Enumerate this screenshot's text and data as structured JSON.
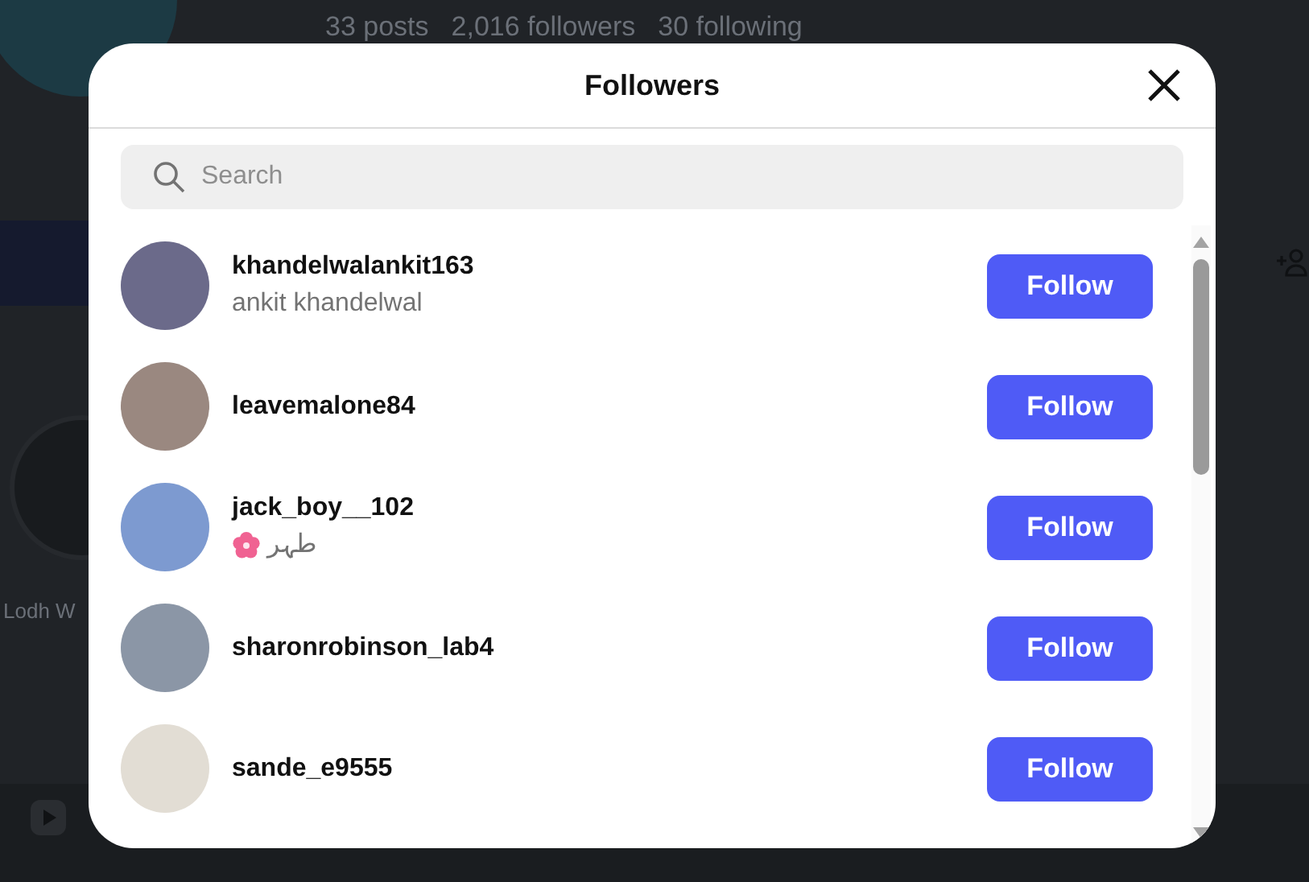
{
  "profile": {
    "stats": [
      "33 posts",
      "2,016 followers",
      "30 following"
    ],
    "highlight_label": "Lodh W"
  },
  "modal": {
    "title": "Followers",
    "search": {
      "placeholder": "Search"
    },
    "followers": [
      {
        "username": "khandelwalankit163",
        "full_name": "ankit khandelwal",
        "flower_badge": false,
        "button": "Follow"
      },
      {
        "username": "leavemalone84",
        "flower_badge": false,
        "button": "Follow"
      },
      {
        "username": "jack_boy__102",
        "full_name": "طہر",
        "flower_badge": true,
        "button": "Follow"
      },
      {
        "username": "sharonrobinson_lab4",
        "flower_badge": false,
        "button": "Follow"
      },
      {
        "username": "sande_e9555",
        "flower_badge": false,
        "button": "Follow"
      }
    ]
  }
}
